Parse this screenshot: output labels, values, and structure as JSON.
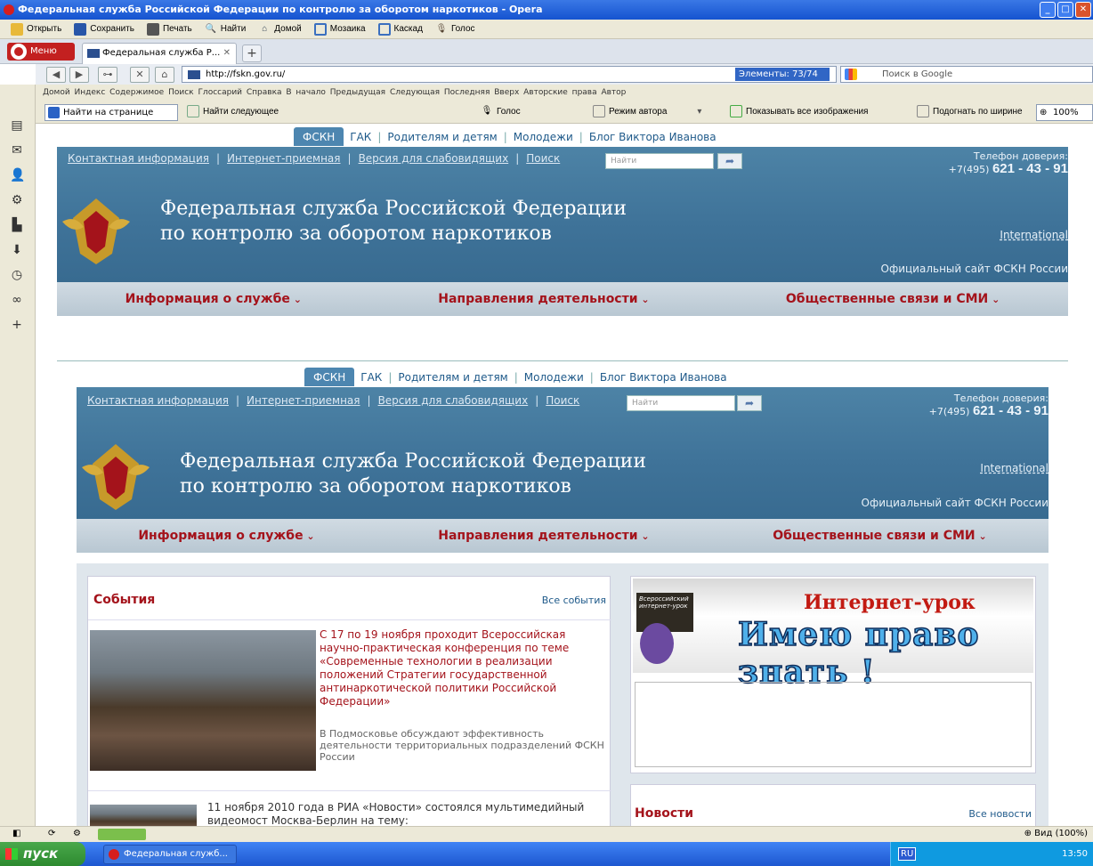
{
  "window": {
    "title": "Федеральная служба Российской Федерации по контролю за оборотом наркотиков - Opera"
  },
  "toolbar": {
    "items": [
      "Открыть",
      "Сохранить",
      "Печать",
      "Найти",
      "Домой",
      "Мозаика",
      "Каскад",
      "Голос"
    ]
  },
  "tabs": {
    "menu_label": "Меню",
    "tab1_label": "Федеральная служба Р...",
    "new_tab": "+"
  },
  "nav": {
    "url": "http://fskn.gov.ru/",
    "elements_label": "Элементы: 73/74",
    "search_placeholder": "Поиск в Google"
  },
  "linkbar": {
    "text": "Домой  Индекс  Содержимое  Поиск  Глоссарий  Справка  В начало  Предыдущая  Следующая  Последняя  Вверх  Авторские права  Автор"
  },
  "findbar": {
    "find_placeholder": "Найти на странице",
    "find_next": "Найти следующее",
    "voice": "Голос",
    "author_mode": "Режим автора",
    "show_images": "Показывать все изображения",
    "fit_width": "Подогнать по ширине",
    "zoom": "100%"
  },
  "site": {
    "tabs": [
      "ФСКН",
      "ГАК",
      "Родителям и детям",
      "Молодежи",
      "Блог Виктора Иванова"
    ],
    "header_links": [
      "Контактная информация",
      "Интернет-приемная",
      "Версия для слабовидящих",
      "Поиск"
    ],
    "search_placeholder": "Найти",
    "phone_label": "Телефон доверия:",
    "phone_prefix": "+7(495)",
    "phone_number": "621 - 43 - 91",
    "title_line1": "Федеральная служба Российской Федерации",
    "title_line2": "по контролю за оборотом наркотиков",
    "international": "International",
    "official": "Официальный сайт ФСКН России",
    "menu": [
      "Информация о службе",
      "Направления деятельности",
      "Общественные связи и СМИ"
    ]
  },
  "events": {
    "title": "События",
    "all_link": "Все события",
    "item1_title": "С 17 по 19 ноября проходит Всероссийская научно-практическая конференция по теме «Современные технологии в реализации положений Стратегии государственной антинаркотической политики Российской Федерации»",
    "item1_sub": "В Подмосковье обсуждают эффективность деятельности территориальных подразделений ФСКН России",
    "item2_text": "11 ноября 2010 года в РИА «Новости» состоялся мультимедийный видеомост Москва-Берлин на тему:"
  },
  "banner": {
    "line1": "Интернет-урок",
    "line2": "Имею право знать !",
    "board": "Всероссийский интернет-урок"
  },
  "news": {
    "title": "Новости",
    "all_link": "Все новости"
  },
  "status": {
    "zoom_label": "Вид (100%)"
  },
  "taskbar": {
    "start": "пуск",
    "task": "Федеральная служб...",
    "lang": "RU",
    "time": "13:50"
  }
}
